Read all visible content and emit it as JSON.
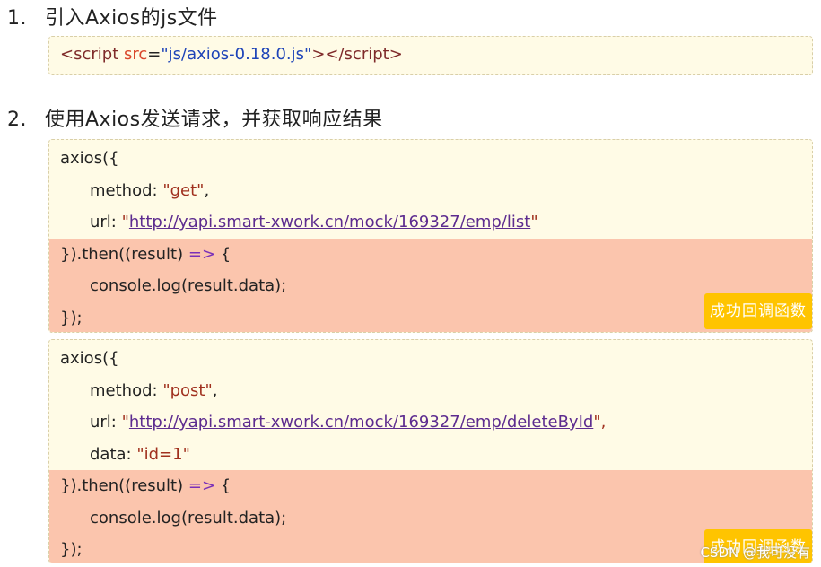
{
  "section1": {
    "number": "1.",
    "title": "引入Axios的js文件",
    "code": {
      "open_bracket": "<",
      "tag": "script",
      "attr": "src",
      "eq": "=",
      "value": "\"js/axios-0.18.0.js\"",
      "close": "></",
      "tag_close": "script",
      "end": ">"
    }
  },
  "section2": {
    "number": "2.",
    "title": "使用Axios发送请求，并获取响应结果",
    "get_request": {
      "line1": "axios({",
      "method_key": "method: ",
      "method_val": "\"get\"",
      "method_comma": ",",
      "url_key": "url: ",
      "url_q1": "\"",
      "url_val": "http://yapi.smart-xwork.cn/mock/169327/emp/list",
      "url_q2": "\"",
      "then_open": "}).then((result) ",
      "arrow": "=>",
      "then_brace": " {",
      "log": "console.log(result.data);",
      "close": "});",
      "badge": "成功回调函数"
    },
    "post_request": {
      "line1": "axios({",
      "method_key": "method: ",
      "method_val": "\"post\"",
      "method_comma": ",",
      "url_key": "url: ",
      "url_q1": "\"",
      "url_val": "http://yapi.smart-xwork.cn/mock/169327/emp/deleteById",
      "url_q2": "\",",
      "data_key": "data: ",
      "data_val": "\"id=1\"",
      "then_open": "}).then((result) ",
      "arrow": "=>",
      "then_brace": " {",
      "log": "console.log(result.data);",
      "close": "});",
      "badge": "成功回调函数"
    }
  },
  "watermark": "CSDN @我可没有"
}
